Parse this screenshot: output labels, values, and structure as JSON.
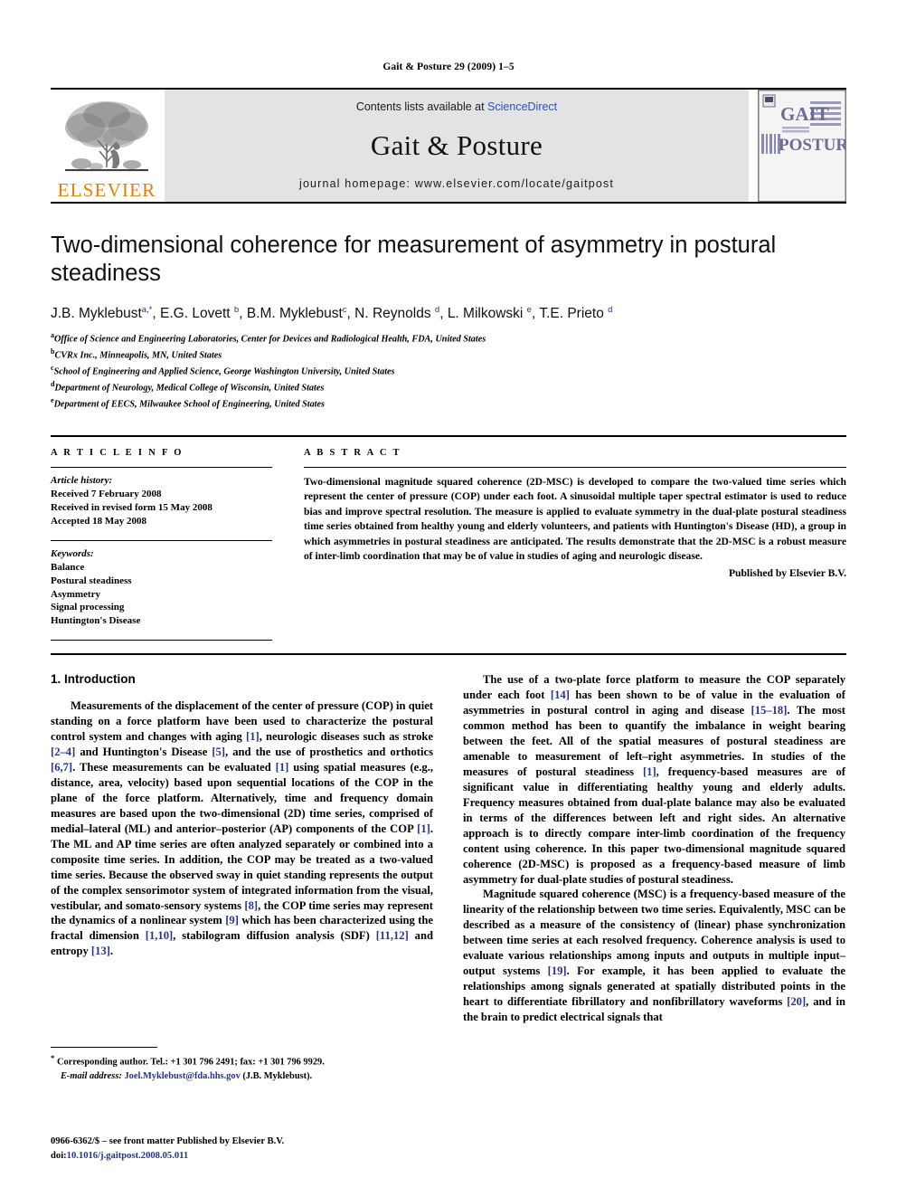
{
  "running_head": "Gait & Posture 29 (2009) 1–5",
  "masthead": {
    "publisher_name": "ELSEVIER",
    "contents_prefix": "Contents lists available at ",
    "sciencedirect_link": "ScienceDirect",
    "journal_title": "Gait & Posture",
    "homepage_line": "journal homepage: www.elsevier.com/locate/gaitpost",
    "cover_line1": "GAIT",
    "cover_amp": "& POSTURE",
    "cover_line2": "POSTURE",
    "link_color": "#2b50c8",
    "brand_color": "#f07d00",
    "band_color": "#e3e3e3"
  },
  "article": {
    "title": "Two-dimensional coherence for measurement of asymmetry in postural steadiness",
    "authors": [
      {
        "name": "J.B. Myklebust",
        "sup": "a,*"
      },
      {
        "name": "E.G. Lovett",
        "sup": "b"
      },
      {
        "name": "B.M. Myklebust",
        "sup": "c"
      },
      {
        "name": "N. Reynolds",
        "sup": "d"
      },
      {
        "name": "L. Milkowski",
        "sup": "e"
      },
      {
        "name": "T.E. Prieto",
        "sup": "d"
      }
    ],
    "affiliations": [
      {
        "sup": "a",
        "text": "Office of Science and Engineering Laboratories, Center for Devices and Radiological Health, FDA, United States"
      },
      {
        "sup": "b",
        "text": "CVRx Inc., Minneapolis, MN, United States"
      },
      {
        "sup": "c",
        "text": "School of Engineering and Applied Science, George Washington University, United States"
      },
      {
        "sup": "d",
        "text": "Department of Neurology, Medical College of Wisconsin, United States"
      },
      {
        "sup": "e",
        "text": "Department of EECS, Milwaukee School of Engineering, United States"
      }
    ]
  },
  "article_info": {
    "label": "A R T I C L E   I N F O",
    "history_label": "Article history:",
    "history": [
      "Received 7 February 2008",
      "Received in revised form 15 May 2008",
      "Accepted 18 May 2008"
    ],
    "keywords_label": "Keywords:",
    "keywords": [
      "Balance",
      "Postural steadiness",
      "Asymmetry",
      "Signal processing",
      "Huntington's Disease"
    ]
  },
  "abstract": {
    "label": "A B S T R A C T",
    "text": "Two-dimensional magnitude squared coherence (2D-MSC) is developed to compare the two-valued time series which represent the center of pressure (COP) under each foot. A sinusoidal multiple taper spectral estimator is used to reduce bias and improve spectral resolution. The measure is applied to evaluate symmetry in the dual-plate postural steadiness time series obtained from healthy young and elderly volunteers, and patients with Huntington's Disease (HD), a group in which asymmetries in postural steadiness are anticipated. The results demonstrate that the 2D-MSC is a robust measure of inter-limb coordination that may be of value in studies of aging and neurologic disease.",
    "published_by": "Published by Elsevier B.V."
  },
  "body": {
    "section_heading": "1. Introduction",
    "left_paragraphs": [
      "Measurements of the displacement of the center of pressure (COP) in quiet standing on a force platform have been used to characterize the postural control system and changes with aging [1], neurologic diseases such as stroke [2–4] and Huntington's Disease [5], and the use of prosthetics and orthotics [6,7]. These measurements can be evaluated [1] using spatial measures (e.g., distance, area, velocity) based upon sequential locations of the COP in the plane of the force platform. Alternatively, time and frequency domain measures are based upon the two-dimensional (2D) time series, comprised of medial–lateral (ML) and anterior–posterior (AP) components of the COP [1]. The ML and AP time series are often analyzed separately or combined into a composite time series. In addition, the COP may be treated as a two-valued time series. Because the observed sway in quiet standing represents the output of the complex sensorimotor system of integrated information from the visual, vestibular, and somato-sensory systems [8], the COP time series may represent the dynamics of a nonlinear system [9] which has been characterized using the fractal dimension [1,10], stabilogram diffusion analysis (SDF) [11,12] and entropy [13]."
    ],
    "right_paragraphs": [
      "The use of a two-plate force platform to measure the COP separately under each foot [14] has been shown to be of value in the evaluation of asymmetries in postural control in aging and disease [15–18]. The most common method has been to quantify the imbalance in weight bearing between the feet. All of the spatial measures of postural steadiness are amenable to measurement of left–right asymmetries. In studies of the measures of postural steadiness [1], frequency-based measures are of significant value in differentiating healthy young and elderly adults. Frequency measures obtained from dual-plate balance may also be evaluated in terms of the differences between left and right sides. An alternative approach is to directly compare inter-limb coordination of the frequency content using coherence. In this paper two-dimensional magnitude squared coherence (2D-MSC) is proposed as a frequency-based measure of limb asymmetry for dual-plate studies of postural steadiness.",
      "Magnitude squared coherence (MSC) is a frequency-based measure of the linearity of the relationship between two time series. Equivalently, MSC can be described as a measure of the consistency of (linear) phase synchronization between time series at each resolved frequency. Coherence analysis is used to evaluate various relationships among inputs and outputs in multiple input–output systems [19]. For example, it has been applied to evaluate the relationships among signals generated at spatially distributed points in the heart to differentiate fibrillatory and nonfibrillatory waveforms [20], and in the brain to predict electrical signals that"
    ]
  },
  "footnote": {
    "marker": "*",
    "line1": "Corresponding author. Tel.: +1 301 796 2491; fax: +1 301 796 9929.",
    "email_label": "E-mail address:",
    "email": "Joel.Myklebust@fda.hhs.gov",
    "email_suffix": "(J.B. Myklebust)."
  },
  "page_footer": {
    "front_matter": "0966-6362/$ – see front matter Published by Elsevier B.V.",
    "doi_label": "doi:",
    "doi": "10.1016/j.gaitpost.2008.05.011"
  }
}
